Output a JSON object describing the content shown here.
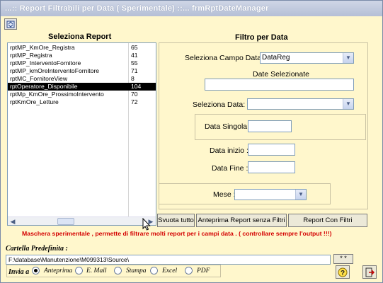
{
  "window": {
    "title": "...:: Report Filtrabili per Data ( Sperimentale) ::...   frmRptDateManager"
  },
  "left": {
    "title": "Seleziona Report",
    "reports": [
      {
        "name": "rptMP_KmOre_Registra",
        "id": "65",
        "selected": false
      },
      {
        "name": "rptMP_Registra",
        "id": "41",
        "selected": false
      },
      {
        "name": "rptMP_InterventoFornitore",
        "id": "55",
        "selected": false
      },
      {
        "name": "rptMP_kmOreInterventoFornitore",
        "id": "71",
        "selected": false
      },
      {
        "name": "rptMC_FornitoreView",
        "id": "8",
        "selected": false
      },
      {
        "name": "rptOperatore_Disponibile",
        "id": "104",
        "selected": true
      },
      {
        "name": "rptMp_KmOre_ProssimoIntervento",
        "id": "70",
        "selected": false
      },
      {
        "name": "rptKmOre_Letture",
        "id": "72",
        "selected": false
      }
    ]
  },
  "filter": {
    "title": "Filtro per Data",
    "campo_label": "Seleziona Campo Data :",
    "campo_value": "DataReg",
    "date_sel_label": "Date Selezionate",
    "date_sel_value": "",
    "sel_data_label": "Seleziona Data:",
    "sel_data_value": "",
    "data_singola_label": "Data Singola:",
    "data_inizio_label": "Data inizio :",
    "data_fine_label": "Data Fine :",
    "mese_label": "Mese :",
    "mese_value": ""
  },
  "buttons": {
    "svuota": "Svuota tutto",
    "anteprima": "Anteprima Report senza Filtri",
    "report_filtri": "Report Con Filtri"
  },
  "warning": "Maschera sperimentale ,  permette di filtrare molti report per i campi data .  ( controllare sempre l'output !!!)",
  "cartella": {
    "label": "Cartella Predefinita :",
    "path": "F:\\database\\Manutenzione\\M099313\\Source\\",
    "browse": "* *"
  },
  "invia": {
    "label": "Invia a",
    "options": [
      "Anteprima",
      "E. Mail",
      "Stampa",
      "Excel",
      "PDF"
    ],
    "selected": "Anteprima"
  },
  "colors": {
    "background": "#fff7cc",
    "warning": "#d40000",
    "selection": "#000000"
  }
}
